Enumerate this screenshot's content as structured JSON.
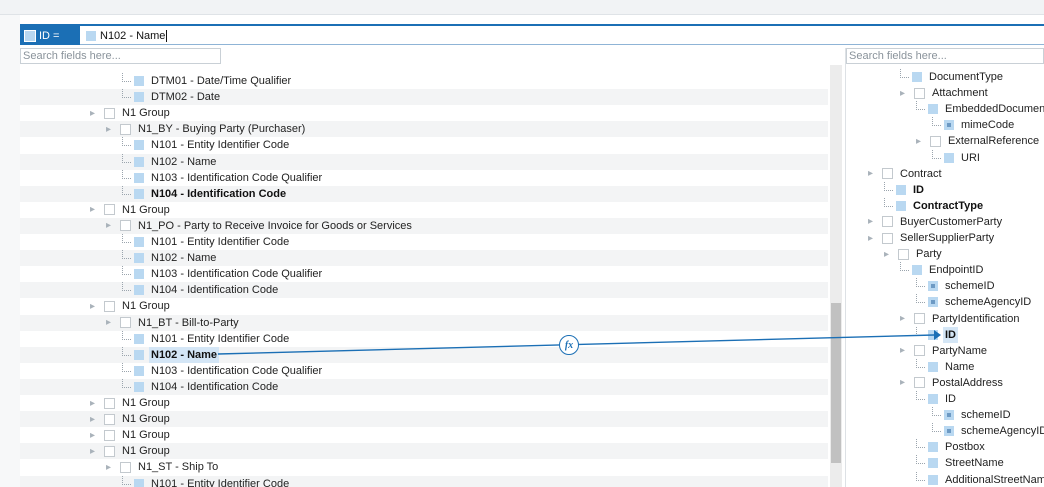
{
  "toolbar": {
    "target_label": "ID =",
    "mapping_source": "N102 - Name"
  },
  "search": {
    "left_placeholder": "Search fields here...",
    "right_placeholder": "Search fields here..."
  },
  "left_tree": [
    {
      "label": "DTM01 - Date/Time Qualifier",
      "indent": 102,
      "kind": "field",
      "stripe": false,
      "bold": false
    },
    {
      "label": "DTM02 - Date",
      "indent": 102,
      "kind": "field",
      "stripe": true,
      "bold": false
    },
    {
      "label": "N1 Group",
      "indent": 70,
      "kind": "group",
      "stripe": false,
      "bold": false
    },
    {
      "label": "N1_BY - Buying Party (Purchaser)",
      "indent": 86,
      "kind": "group",
      "stripe": true,
      "bold": false
    },
    {
      "label": "N101 - Entity Identifier Code",
      "indent": 102,
      "kind": "field",
      "stripe": false,
      "bold": false
    },
    {
      "label": "N102 - Name",
      "indent": 102,
      "kind": "field",
      "stripe": true,
      "bold": false
    },
    {
      "label": "N103 - Identification Code Qualifier",
      "indent": 102,
      "kind": "field",
      "stripe": false,
      "bold": false
    },
    {
      "label": "N104 - Identification Code",
      "indent": 102,
      "kind": "field",
      "stripe": true,
      "bold": true
    },
    {
      "label": "N1 Group",
      "indent": 70,
      "kind": "group",
      "stripe": false,
      "bold": false
    },
    {
      "label": "N1_PO - Party to Receive Invoice for Goods or Services",
      "indent": 86,
      "kind": "group",
      "stripe": true,
      "bold": false
    },
    {
      "label": "N101 - Entity Identifier Code",
      "indent": 102,
      "kind": "field",
      "stripe": false,
      "bold": false
    },
    {
      "label": "N102 - Name",
      "indent": 102,
      "kind": "field",
      "stripe": true,
      "bold": false
    },
    {
      "label": "N103 - Identification Code Qualifier",
      "indent": 102,
      "kind": "field",
      "stripe": false,
      "bold": false
    },
    {
      "label": "N104 - Identification Code",
      "indent": 102,
      "kind": "field",
      "stripe": true,
      "bold": false
    },
    {
      "label": "N1 Group",
      "indent": 70,
      "kind": "group",
      "stripe": false,
      "bold": false
    },
    {
      "label": "N1_BT - Bill-to-Party",
      "indent": 86,
      "kind": "group",
      "stripe": true,
      "bold": false
    },
    {
      "label": "N101 - Entity Identifier Code",
      "indent": 102,
      "kind": "field",
      "stripe": false,
      "bold": false
    },
    {
      "label": "N102 - Name",
      "indent": 102,
      "kind": "field",
      "stripe": true,
      "bold": true,
      "selected": true
    },
    {
      "label": "N103 - Identification Code Qualifier",
      "indent": 102,
      "kind": "field",
      "stripe": false,
      "bold": false
    },
    {
      "label": "N104 - Identification Code",
      "indent": 102,
      "kind": "field",
      "stripe": true,
      "bold": false
    },
    {
      "label": "N1 Group",
      "indent": 70,
      "kind": "group",
      "stripe": false,
      "bold": false
    },
    {
      "label": "N1 Group",
      "indent": 70,
      "kind": "group",
      "stripe": true,
      "bold": false
    },
    {
      "label": "N1 Group",
      "indent": 70,
      "kind": "group",
      "stripe": false,
      "bold": false
    },
    {
      "label": "N1 Group",
      "indent": 70,
      "kind": "group",
      "stripe": true,
      "bold": false
    },
    {
      "label": "N1_ST - Ship To",
      "indent": 86,
      "kind": "group",
      "stripe": false,
      "bold": false
    },
    {
      "label": "N101 - Entity Identifier Code",
      "indent": 102,
      "kind": "field",
      "stripe": true,
      "bold": false
    }
  ],
  "right_tree": [
    {
      "label": "DocumentType",
      "indent": 54,
      "kind": "field",
      "bold": false
    },
    {
      "label": "Attachment",
      "indent": 54,
      "kind": "group",
      "bold": false
    },
    {
      "label": "EmbeddedDocumentBinaryObject",
      "indent": 70,
      "kind": "field",
      "bold": false
    },
    {
      "label": "mimeCode",
      "indent": 86,
      "kind": "attribute",
      "bold": false
    },
    {
      "label": "ExternalReference",
      "indent": 70,
      "kind": "group",
      "bold": false
    },
    {
      "label": "URI",
      "indent": 86,
      "kind": "field",
      "bold": false
    },
    {
      "label": "Contract",
      "indent": 22,
      "kind": "group",
      "bold": false
    },
    {
      "label": "ID",
      "indent": 38,
      "kind": "field",
      "bold": true
    },
    {
      "label": "ContractType",
      "indent": 38,
      "kind": "field",
      "bold": true
    },
    {
      "label": "BuyerCustomerParty",
      "indent": 22,
      "kind": "group",
      "bold": false
    },
    {
      "label": "SellerSupplierParty",
      "indent": 22,
      "kind": "group",
      "bold": false
    },
    {
      "label": "Party",
      "indent": 38,
      "kind": "group",
      "bold": false
    },
    {
      "label": "EndpointID",
      "indent": 54,
      "kind": "field",
      "bold": false
    },
    {
      "label": "schemeID",
      "indent": 70,
      "kind": "attribute",
      "bold": false
    },
    {
      "label": "schemeAgencyID",
      "indent": 70,
      "kind": "attribute",
      "bold": false
    },
    {
      "label": "PartyIdentification",
      "indent": 54,
      "kind": "group",
      "bold": false
    },
    {
      "label": "ID",
      "indent": 70,
      "kind": "field",
      "bold": true,
      "selected": true
    },
    {
      "label": "PartyName",
      "indent": 54,
      "kind": "group",
      "bold": false
    },
    {
      "label": "Name",
      "indent": 70,
      "kind": "field",
      "bold": false
    },
    {
      "label": "PostalAddress",
      "indent": 54,
      "kind": "group",
      "bold": false
    },
    {
      "label": "ID",
      "indent": 70,
      "kind": "field",
      "bold": false
    },
    {
      "label": "schemeID",
      "indent": 86,
      "kind": "attribute",
      "bold": false
    },
    {
      "label": "schemeAgencyID",
      "indent": 86,
      "kind": "attribute",
      "bold": false
    },
    {
      "label": "Postbox",
      "indent": 70,
      "kind": "field",
      "bold": false
    },
    {
      "label": "StreetName",
      "indent": 70,
      "kind": "field",
      "bold": false
    },
    {
      "label": "AdditionalStreetName",
      "indent": 70,
      "kind": "field",
      "bold": false
    }
  ],
  "mapping": {
    "function_icon": "fx-icon",
    "line_color": "#1b6fb5"
  }
}
